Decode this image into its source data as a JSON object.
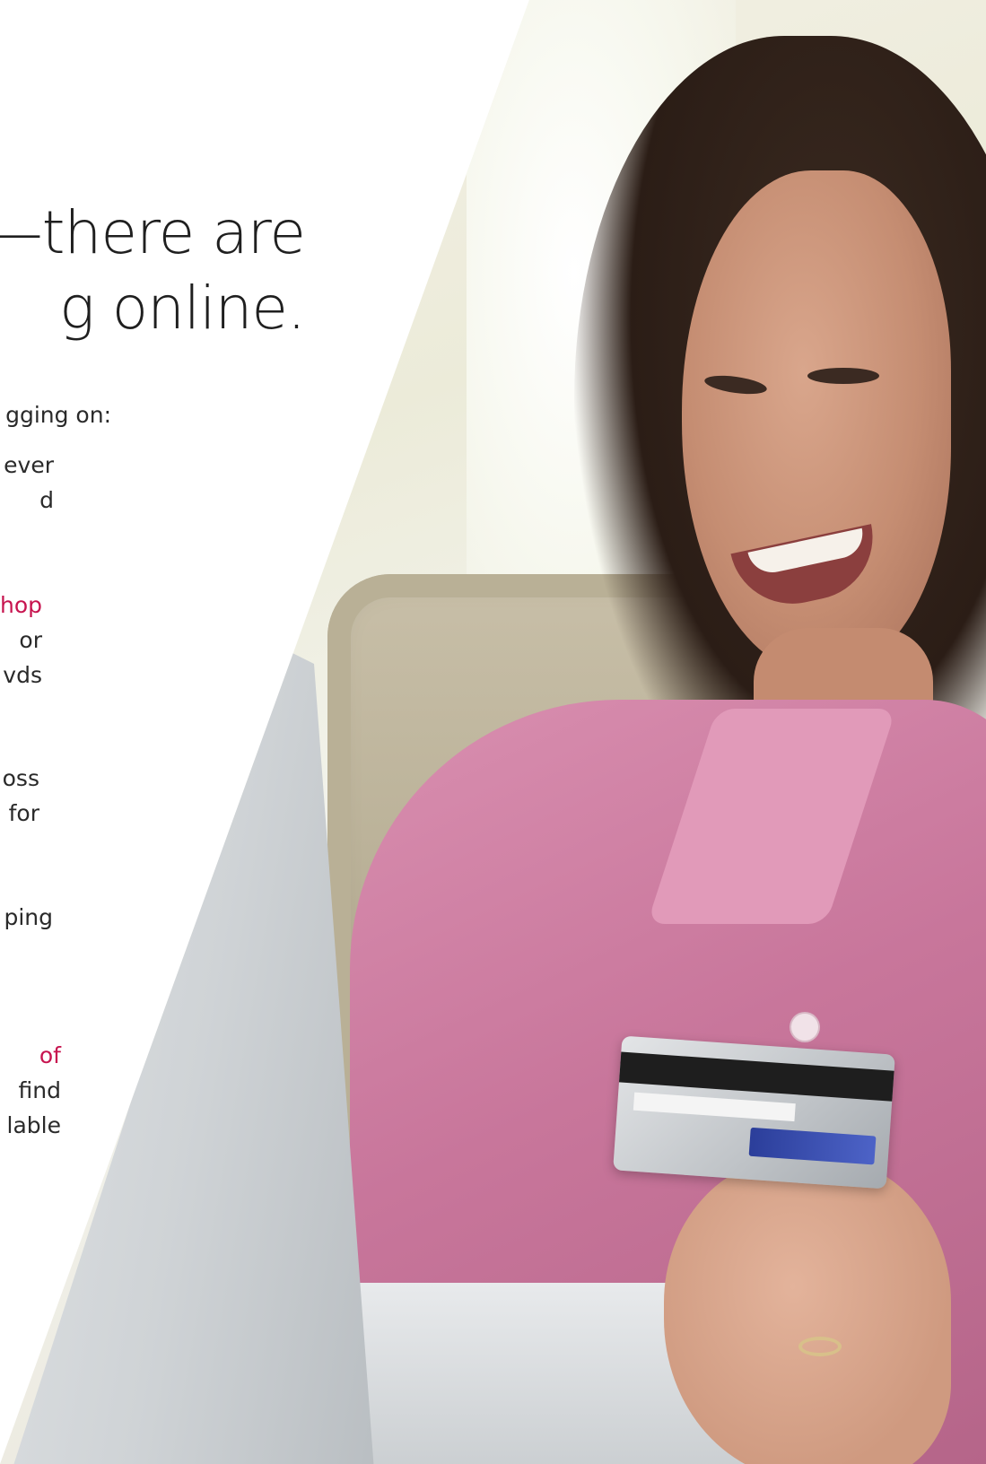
{
  "headline": {
    "line1": "—there are",
    "line2": "g online."
  },
  "intro": "gging on:",
  "items": [
    {
      "lines": [
        "ever",
        "d"
      ]
    },
    {
      "accent": "hop",
      "lines": [
        "or",
        "vds"
      ]
    },
    {
      "lines": [
        "oss",
        "for"
      ]
    },
    {
      "lines": [
        "ping"
      ]
    },
    {
      "accent": "of",
      "lines": [
        "find",
        "lable"
      ]
    }
  ],
  "colors": {
    "accent": "#c7144f",
    "text": "#2a2a2a",
    "background": "#ffffff"
  }
}
